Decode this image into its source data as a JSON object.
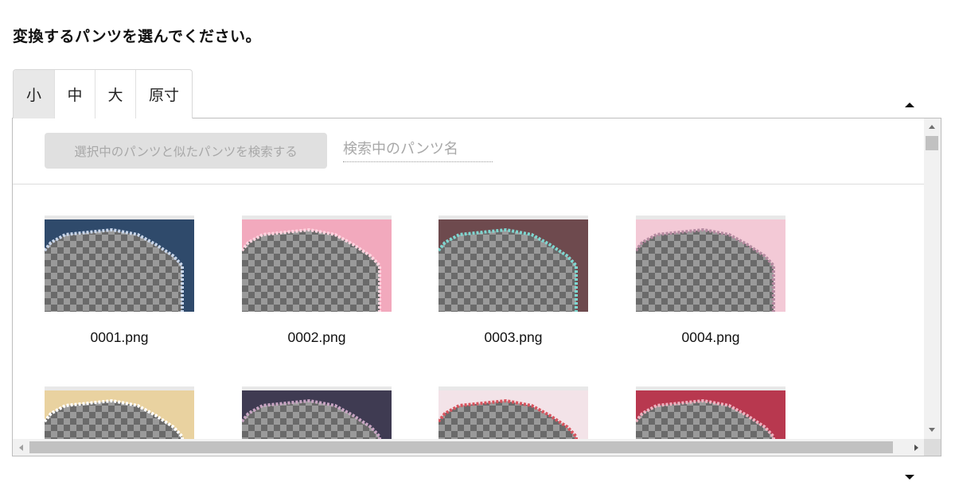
{
  "heading": "変換するパンツを選んでください。",
  "tabs": [
    {
      "label": "小",
      "active": true
    },
    {
      "label": "中",
      "active": false
    },
    {
      "label": "大",
      "active": false
    },
    {
      "label": "原寸",
      "active": false
    }
  ],
  "toolbar": {
    "similar_button_label": "選択中のパンツと似たパンツを検索する",
    "search_placeholder": "検索中のパンツ名"
  },
  "items": [
    {
      "filename": "0001.png",
      "palette": [
        "#2f4a6b",
        "#c9d6ea"
      ]
    },
    {
      "filename": "0002.png",
      "palette": [
        "#f2a9bd",
        "#ffd6e1"
      ]
    },
    {
      "filename": "0003.png",
      "palette": [
        "#6e4a4e",
        "#7fd6d0"
      ]
    },
    {
      "filename": "0004.png",
      "palette": [
        "#f3c9d6",
        "#b58aa0"
      ]
    },
    {
      "filename": "",
      "palette": [
        "#e9d2a0",
        "#ffffff"
      ]
    },
    {
      "filename": "",
      "palette": [
        "#3f3b52",
        "#c9a6c4"
      ]
    },
    {
      "filename": "",
      "palette": [
        "#f3e3e8",
        "#d8545e"
      ]
    },
    {
      "filename": "",
      "palette": [
        "#b8384f",
        "#f0b2c0"
      ]
    }
  ],
  "colors": {
    "accent": "#e8e8e8",
    "button_disabled_bg": "#e0e0e0",
    "button_disabled_text": "#a8a8a8"
  }
}
